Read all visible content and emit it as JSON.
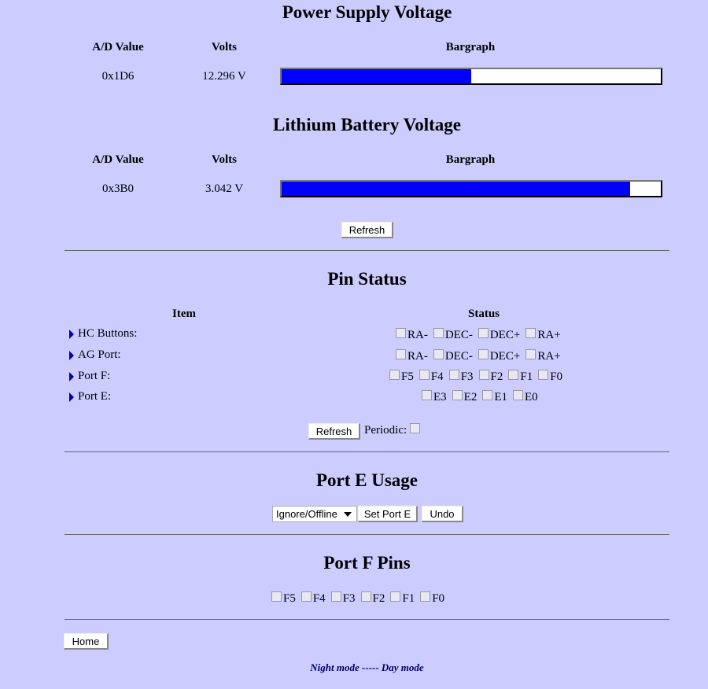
{
  "power": {
    "title": "Power Supply Voltage",
    "headers": {
      "ad": "A/D Value",
      "volts": "Volts",
      "bar": "Bargraph"
    },
    "ad_value": "0x1D6",
    "volts": "12.296 V",
    "bar_level": 0.5
  },
  "battery": {
    "title": "Lithium Battery Voltage",
    "headers": {
      "ad": "A/D Value",
      "volts": "Volts",
      "bar": "Bargraph"
    },
    "ad_value": "0x3B0",
    "volts": "3.042 V",
    "bar_level": 0.92
  },
  "refresh1_label": "Refresh",
  "pin_status": {
    "title": "Pin Status",
    "col_item": "Item",
    "col_status": "Status",
    "rows": [
      {
        "label": "HC Buttons:",
        "pins": [
          "RA-",
          "DEC-",
          "DEC+",
          "RA+"
        ]
      },
      {
        "label": "AG Port:",
        "pins": [
          "RA-",
          "DEC-",
          "DEC+",
          "RA+"
        ]
      },
      {
        "label": "Port F:",
        "pins": [
          "F5",
          "F4",
          "F3",
          "F2",
          "F1",
          "F0"
        ]
      },
      {
        "label": "Port E:",
        "pins": [
          "E3",
          "E2",
          "E1",
          "E0"
        ]
      }
    ],
    "refresh_label": "Refresh",
    "periodic_label": "Periodic:"
  },
  "port_e": {
    "title": "Port E Usage",
    "selected": "Ignore/Offline",
    "set_label": "Set Port E",
    "undo_label": "Undo"
  },
  "port_f": {
    "title": "Port F Pins",
    "pins": [
      "F5",
      "F4",
      "F3",
      "F2",
      "F1",
      "F0"
    ]
  },
  "home_label": "Home",
  "footer": "Night mode ----- Day mode",
  "colors": {
    "background": "#ccccff",
    "bar_fill": "#0000ff",
    "footer": "#000066"
  }
}
